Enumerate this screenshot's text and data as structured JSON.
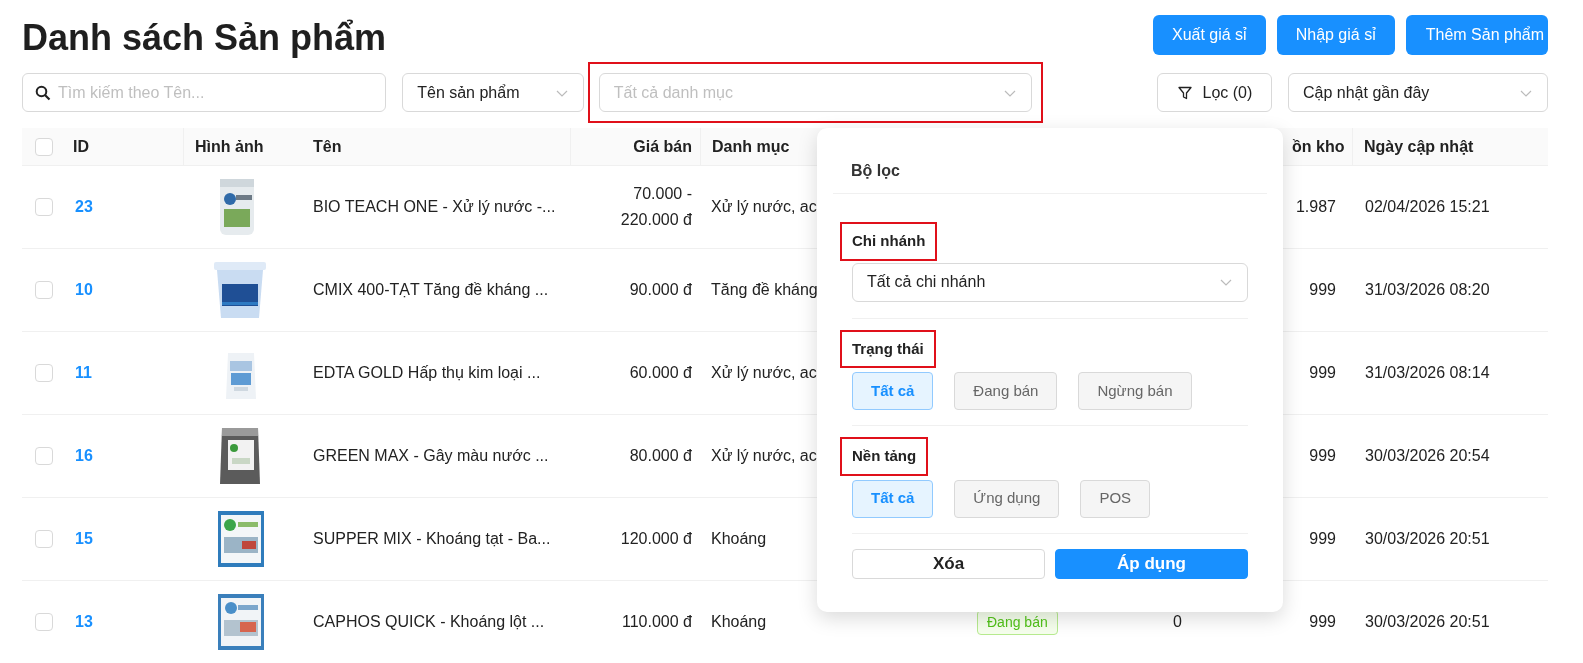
{
  "title": "Danh sách Sản phẩm",
  "actions": [
    "Xuất giá sỉ",
    "Nhập giá sỉ",
    "Thêm Sản phẩm"
  ],
  "search": {
    "placeholder": "Tìm kiếm theo Tên..."
  },
  "search_by": {
    "value": "Tên sản phẩm"
  },
  "category_select": {
    "placeholder": "Tất cả danh mục",
    "highlighted": true
  },
  "filter_button": {
    "label": "Lọc (0)"
  },
  "sort_select": {
    "value": "Cập nhật gần đây"
  },
  "table": {
    "header_checked": false,
    "columns": [
      "ID",
      "Hình ảnh",
      "Tên",
      "Giá bán",
      "Danh mục",
      "ồn kho",
      "Ngày cập nhật"
    ],
    "rows": [
      {
        "checked": false,
        "id": "23",
        "name": "BIO TEACH ONE - Xử lý nước -...",
        "price": "70.000 - 220.000 đ",
        "category": "Xử lý nước, ac",
        "stock": "1.987",
        "updated": "02/04/2026 15:21"
      },
      {
        "checked": false,
        "id": "10",
        "name": "CMIX 400-TẠT Tăng đề kháng ...",
        "price": "90.000 đ",
        "category": "Tăng đề kháng",
        "stock": "999",
        "updated": "31/03/2026 08:20"
      },
      {
        "checked": false,
        "id": "11",
        "name": "EDTA GOLD Hấp thụ kim loại ...",
        "price": "60.000 đ",
        "category": "Xử lý nước, ac",
        "stock": "999",
        "updated": "31/03/2026 08:14"
      },
      {
        "checked": false,
        "id": "16",
        "name": "GREEN MAX - Gây màu nước ...",
        "price": "80.000 đ",
        "category": "Xử lý nước, ac",
        "stock": "999",
        "updated": "30/03/2026 20:54"
      },
      {
        "checked": false,
        "id": "15",
        "name": "SUPPER MIX - Khoáng tạt - Ba...",
        "price": "120.000 đ",
        "category": "Khoáng",
        "stock": "999",
        "updated": "30/03/2026 20:51"
      },
      {
        "checked": false,
        "id": "13",
        "name": "CAPHOS QUICK - Khoáng lột ...",
        "price": "110.000 đ",
        "category": "Khoáng",
        "status": "Đang bán",
        "column_8": "0",
        "stock": "999",
        "updated": "30/03/2026 20:51"
      }
    ]
  },
  "filter_popover": {
    "title": "Bộ lọc",
    "sections": [
      {
        "kind": "select",
        "label": "Chi nhánh",
        "highlighted": true,
        "value": "Tất cả chi nhánh"
      },
      {
        "kind": "chips",
        "label": "Trạng thái",
        "highlighted": true,
        "options": [
          {
            "label": "Tất cả",
            "selected": true
          },
          {
            "label": "Đang bán",
            "selected": false
          },
          {
            "label": "Ngừng bán",
            "selected": false
          }
        ]
      },
      {
        "kind": "chips",
        "label": "Nền tảng",
        "highlighted": true,
        "options": [
          {
            "label": "Tất cả",
            "selected": true
          },
          {
            "label": "Ứng dụng",
            "selected": false
          },
          {
            "label": "POS",
            "selected": false
          }
        ]
      }
    ],
    "buttons": [
      {
        "label": "Xóa",
        "kind": "secondary"
      },
      {
        "label": "Áp dụng",
        "kind": "primary"
      }
    ]
  }
}
